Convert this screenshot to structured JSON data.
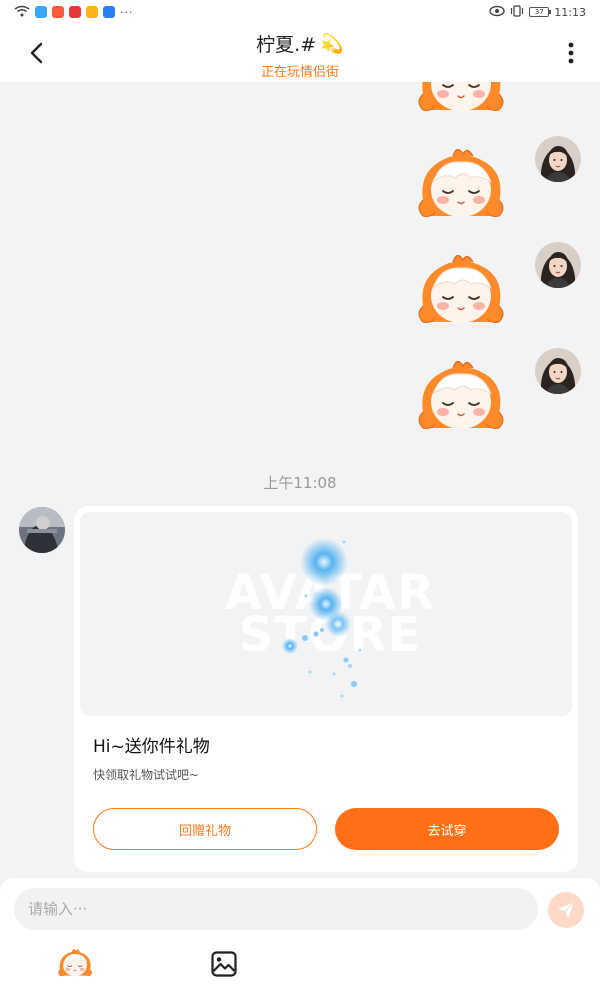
{
  "status_bar": {
    "time": "11:13",
    "battery": "37",
    "overflow": "···"
  },
  "header": {
    "back_icon": "chevron-left-icon",
    "title": "柠夏.#",
    "title_emoji": "💫",
    "subtitle": "正在玩情侣街",
    "more_icon": "vertical-dots-icon"
  },
  "messages": {
    "timestamp": "上午11:08",
    "sent_stickers": [
      {
        "sticker": "orange-hair-girl-sticker",
        "sender": "self"
      },
      {
        "sticker": "orange-hair-girl-sticker",
        "sender": "self"
      },
      {
        "sticker": "orange-hair-girl-sticker",
        "sender": "self"
      },
      {
        "sticker": "orange-hair-girl-sticker",
        "sender": "self"
      }
    ],
    "gift_card": {
      "watermark_line1": "AVATAR",
      "watermark_line2": "STORE",
      "title": "Hi~送你件礼物",
      "description": "快领取礼物试试吧~",
      "return_button": "回赠礼物",
      "try_button": "去试穿"
    }
  },
  "input_bar": {
    "placeholder": "请输入···",
    "send_icon": "paper-plane-icon",
    "sticker_tool_icon": "sticker-icon",
    "image_tool_icon": "image-icon"
  },
  "colors": {
    "accent": "#ff7016",
    "subtitle": "#ff7a1a",
    "background": "#f2f3f5",
    "send_disabled": "#ffd9c7"
  }
}
